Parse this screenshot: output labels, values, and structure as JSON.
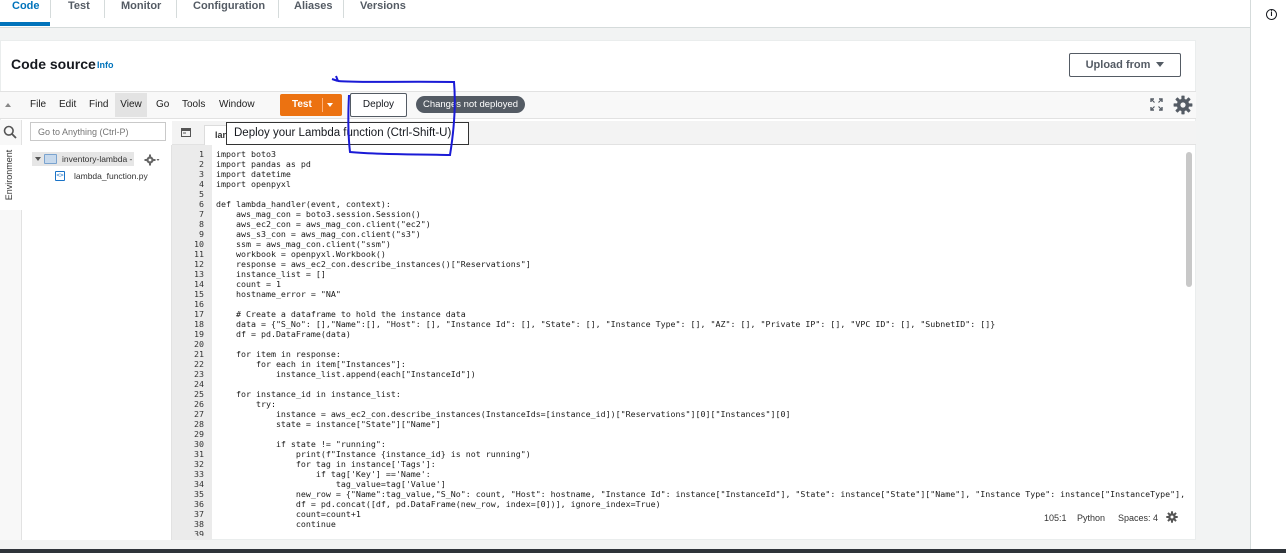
{
  "tabs": [
    {
      "label": "Code",
      "active": true
    },
    {
      "label": "Test",
      "active": false
    },
    {
      "label": "Monitor",
      "active": false
    },
    {
      "label": "Configuration",
      "active": false
    },
    {
      "label": "Aliases",
      "active": false
    },
    {
      "label": "Versions",
      "active": false
    }
  ],
  "header": {
    "title": "Code source",
    "info_link": "Info",
    "upload_label": "Upload from"
  },
  "menu": {
    "items": [
      "File",
      "Edit",
      "Find",
      "View",
      "Go",
      "Tools",
      "Window"
    ],
    "active": "View",
    "test_label": "Test",
    "deploy_label": "Deploy",
    "status_badge": "Changes not deployed"
  },
  "sidebar": {
    "env_label": "Environment",
    "goto_placeholder": "Go to Anything (Ctrl-P)",
    "folder": "inventory-lambda -",
    "file": "lambda_function.py"
  },
  "editor": {
    "tab_label": "lan",
    "tooltip": "Deploy your Lambda function (Ctrl-Shift-U)",
    "lines": [
      "import boto3",
      "import pandas as pd",
      "import datetime",
      "import openpyxl",
      "",
      "def lambda_handler(event, context):",
      "    aws_mag_con = boto3.session.Session()",
      "    aws_ec2_con = aws_mag_con.client(\"ec2\")",
      "    aws_s3_con = aws_mag_con.client(\"s3\")",
      "    ssm = aws_mag_con.client(\"ssm\")",
      "    workbook = openpyxl.Workbook()",
      "    response = aws_ec2_con.describe_instances()[\"Reservations\"]",
      "    instance_list = []",
      "    count = 1",
      "    hostname_error = \"NA\"",
      "",
      "    # Create a dataframe to hold the instance data",
      "    data = {\"S_No\": [],\"Name\":[], \"Host\": [], \"Instance Id\": [], \"State\": [], \"Instance Type\": [], \"AZ\": [], \"Private IP\": [], \"VPC ID\": [], \"SubnetID\": []}",
      "    df = pd.DataFrame(data)",
      "",
      "    for item in response:",
      "        for each in item[\"Instances\"]:",
      "            instance_list.append(each[\"InstanceId\"])",
      "",
      "    for instance_id in instance_list:",
      "        try:",
      "            instance = aws_ec2_con.describe_instances(InstanceIds=[instance_id])[\"Reservations\"][0][\"Instances\"][0]",
      "            state = instance[\"State\"][\"Name\"]",
      "",
      "            if state != \"running\":",
      "                print(f\"Instance {instance_id} is not running\")",
      "                for tag in instance['Tags']:",
      "                    if tag['Key'] =='Name':",
      "                        tag_value=tag['Value']",
      "                new_row = {\"Name\":tag_value,\"S_No\": count, \"Host\": hostname, \"Instance Id\": instance[\"InstanceId\"], \"State\": instance[\"State\"][\"Name\"], \"Instance Type\": instance[\"InstanceType\"], \"",
      "                df = pd.concat([df, pd.DataFrame(new_row, index=[0])], ignore_index=True)",
      "                count=count+1",
      "                continue",
      ""
    ]
  },
  "status": {
    "position": "105:1",
    "language": "Python",
    "spaces": "Spaces: 4"
  },
  "colors": {
    "accent": "#0073bb",
    "test_button": "#ec7211",
    "badge": "#545b64",
    "annotation": "#1a1ad6"
  }
}
